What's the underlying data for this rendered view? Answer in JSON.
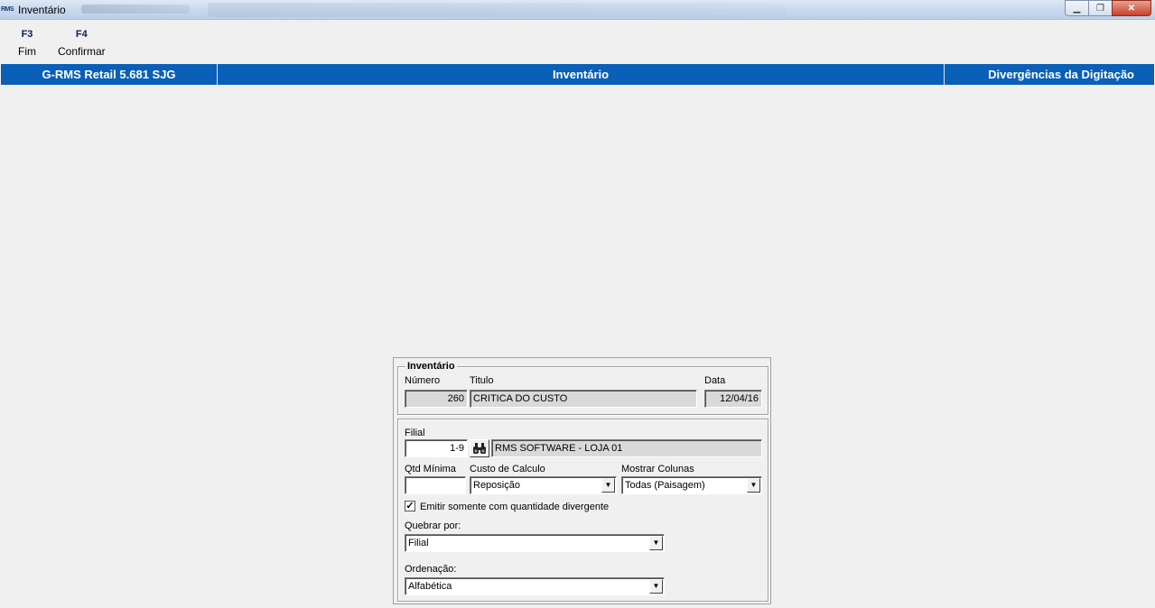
{
  "window": {
    "title": "Inventário",
    "app_icon_text": "RMS",
    "controls": {
      "minimize": "▁",
      "maximize": "❐",
      "close": "✕"
    }
  },
  "toolbar": {
    "fkeys": [
      {
        "key": "F3",
        "label": "Fim"
      },
      {
        "key": "F4",
        "label": "Confirmar"
      }
    ]
  },
  "header": {
    "system": "G-RMS Retail 5.681 SJG",
    "module": "Inventário",
    "screen": "Divergências da Digitação"
  },
  "inventario_group": {
    "title": "Inventário",
    "numero_label": "Número",
    "numero_value": "260",
    "titulo_label": "Titulo",
    "titulo_value": "CRITICA DO CUSTO",
    "data_label": "Data",
    "data_value": "12/04/16"
  },
  "options_group": {
    "filial_label": "Filial",
    "filial_value": "1-9",
    "filial_name": "RMS SOFTWARE - LOJA 01",
    "qtd_minima_label": "Qtd Mínima",
    "qtd_minima_value": "",
    "custo_label": "Custo de Calculo",
    "custo_value": "Reposição",
    "mostrar_label": "Mostrar Colunas",
    "mostrar_value": "Todas (Paisagem)",
    "emitir_label": "Emitir somente com quantidade divergente",
    "emitir_checked": true,
    "quebrar_label": "Quebrar por:",
    "quebrar_value": "Filial",
    "ordenacao_label": "Ordenação:",
    "ordenacao_value": "Alfabética"
  }
}
